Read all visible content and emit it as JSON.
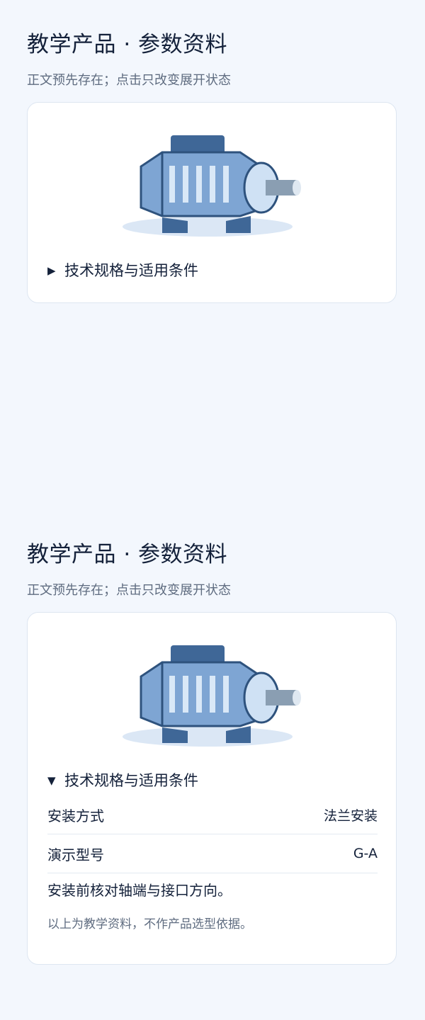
{
  "sections": [
    {
      "title": "教学产品 · 参数资料",
      "subtitle": "正文预先存在；点击只改变展开状态",
      "details": {
        "state": "collapsed",
        "marker": "▶",
        "summary": "技术规格与适用条件"
      }
    },
    {
      "title": "教学产品 · 参数资料",
      "subtitle": "正文预先存在；点击只改变展开状态",
      "details": {
        "state": "expanded",
        "marker": "▼",
        "summary": "技术规格与适用条件",
        "specs": [
          {
            "label": "安装方式",
            "value": "法兰安装"
          },
          {
            "label": "演示型号",
            "value": "G-A"
          }
        ],
        "note": "安装前核对轴端与接口方向。",
        "disclaimer": "以上为教学资料，不作产品选型依据。"
      }
    }
  ],
  "icons": {
    "illustration": "motor-illustration",
    "collapsed_marker": "triangle-right-icon",
    "expanded_marker": "triangle-down-icon"
  },
  "colors": {
    "background": "#f3f7fd",
    "card": "#ffffff",
    "text": "#14213a",
    "muted": "#5f6c80",
    "motor_dark": "#3f6797",
    "motor_body": "#7ea5d3",
    "motor_light": "#cfe1f4",
    "shadow": "#dbe7f5"
  }
}
